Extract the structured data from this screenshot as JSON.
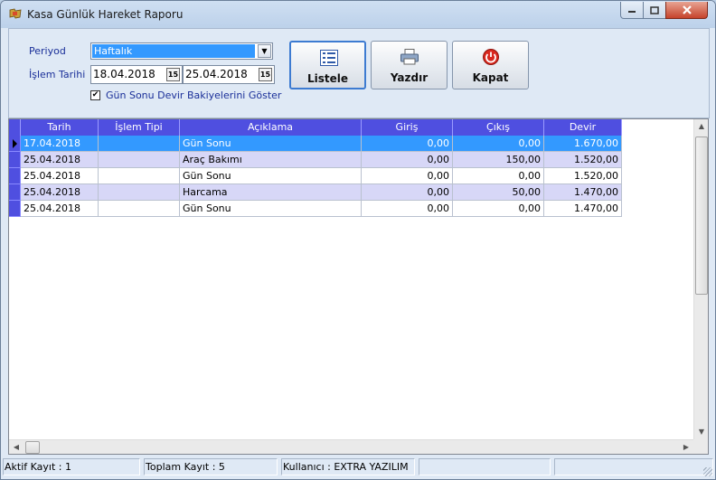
{
  "window": {
    "title": "Kasa Günlük Hareket Raporu"
  },
  "filters": {
    "period_label": "Periyod",
    "period_value": "Haftalık",
    "date_label": "İşlem Tarihi",
    "date_from": "18.04.2018",
    "date_to": "25.04.2018",
    "calendar_glyph": "15",
    "show_carryover_checked": true,
    "show_carryover_label": "Gün Sonu Devir Bakiyelerini Göster"
  },
  "toolbar": {
    "list_label": "Listele",
    "print_label": "Yazdır",
    "close_label": "Kapat"
  },
  "table": {
    "columns": [
      "Tarih",
      "İşlem Tipi",
      "Açıklama",
      "Giriş",
      "Çıkış",
      "Devir"
    ],
    "rows": [
      [
        "17.04.2018",
        "",
        "Gün Sonu",
        "0,00",
        "0,00",
        "1.670,00"
      ],
      [
        "25.04.2018",
        "",
        "Araç Bakımı",
        "0,00",
        "150,00",
        "1.520,00"
      ],
      [
        "25.04.2018",
        "",
        "Gün Sonu",
        "0,00",
        "0,00",
        "1.520,00"
      ],
      [
        "25.04.2018",
        "",
        "Harcama",
        "0,00",
        "50,00",
        "1.470,00"
      ],
      [
        "25.04.2018",
        "",
        "Gün Sonu",
        "0,00",
        "0,00",
        "1.470,00"
      ]
    ]
  },
  "status": {
    "active_record": "Aktif Kayıt : 1",
    "total_records": "Toplam Kayıt : 5",
    "user": "Kullanıcı : EXTRA YAZILIM"
  },
  "colors": {
    "header_bg": "#4f4fe0",
    "selected_row": "#3399ff",
    "alt_row": "#d7d7f7",
    "label_text": "#1a2f99"
  }
}
